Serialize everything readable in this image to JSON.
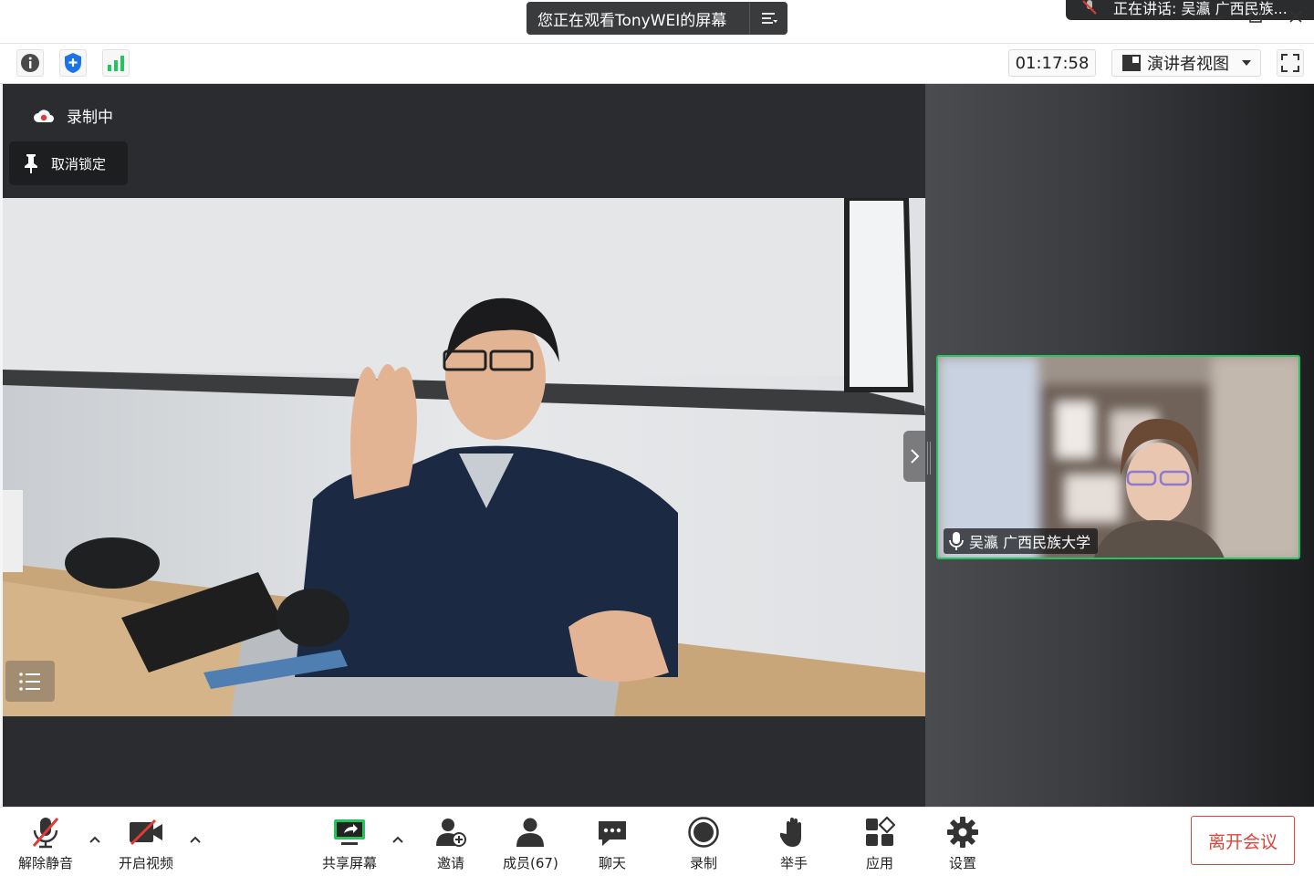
{
  "banner": {
    "viewing_text": "您正在观看TonyWEI的屏幕",
    "speaking_text": "正在讲话: 吴瀛 广西民族..."
  },
  "info": {
    "timer": "01:17:58",
    "view_mode": "演讲者视图"
  },
  "stage": {
    "recording_label": "录制中",
    "unpin_label": "取消锁定"
  },
  "gallery": {
    "participant_name": "吴瀛 广西民族大学"
  },
  "toolbar": {
    "unmute": "解除静音",
    "start_video": "开启视频",
    "share_screen": "共享屏幕",
    "invite": "邀请",
    "members": "成员(67)",
    "chat": "聊天",
    "record": "录制",
    "raise_hand": "举手",
    "apps": "应用",
    "settings": "设置",
    "leave": "离开会议"
  },
  "colors": {
    "accent_green": "#22c55e",
    "leave_red": "#e0433a",
    "shield_blue": "#1a73e8",
    "record_red": "#e53935"
  }
}
